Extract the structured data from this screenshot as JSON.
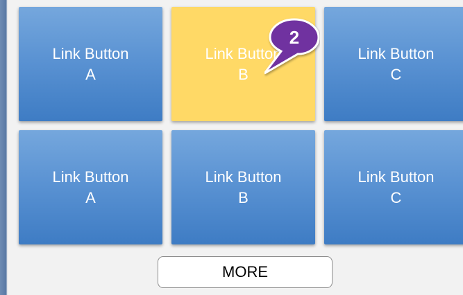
{
  "grid": {
    "rows": [
      {
        "tiles": [
          {
            "label": "Link Button\nA"
          },
          {
            "label": "Link Button\nB"
          },
          {
            "label": "Link Button\nC"
          }
        ]
      },
      {
        "tiles": [
          {
            "label": "Link Button\nA"
          },
          {
            "label": "Link Button\nB"
          },
          {
            "label": "Link Button\nC"
          }
        ]
      }
    ]
  },
  "callout": {
    "number": "2",
    "color": "#7030a0"
  },
  "highlight_color": "#ffd966",
  "tile_color": "#5b93d3",
  "more_button": {
    "label": "MORE"
  }
}
